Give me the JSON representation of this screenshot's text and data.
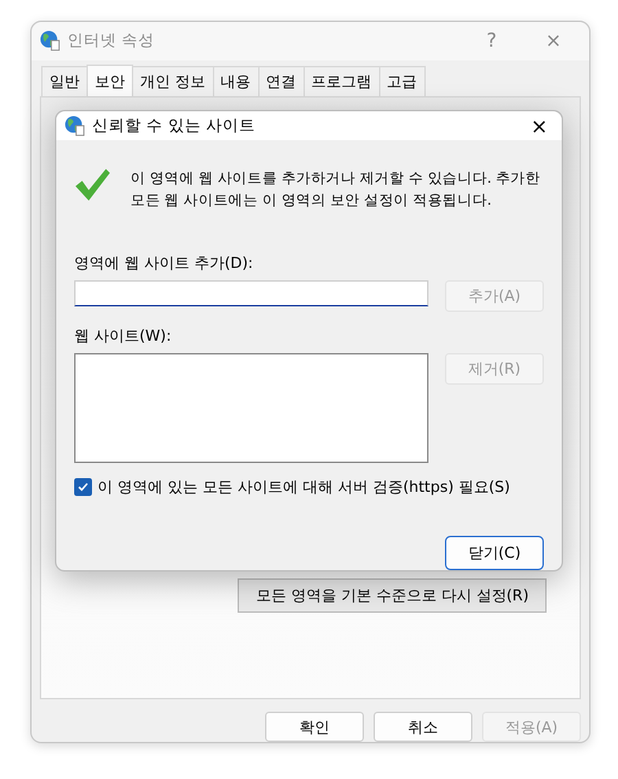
{
  "window": {
    "title": "인터넷 속성",
    "help_button": "?",
    "close_button": "×"
  },
  "tabs": [
    {
      "label": "일반",
      "selected": false
    },
    {
      "label": "보안",
      "selected": true
    },
    {
      "label": "개인 정보",
      "selected": false
    },
    {
      "label": "내용",
      "selected": false
    },
    {
      "label": "연결",
      "selected": false
    },
    {
      "label": "프로그램",
      "selected": false
    },
    {
      "label": "고급",
      "selected": false
    }
  ],
  "security_panel": {
    "reset_button": "모든 영역을 기본 수준으로 다시 설정(R)"
  },
  "buttons": [
    {
      "label": "확인",
      "disabled": false
    },
    {
      "label": "취소",
      "disabled": false
    },
    {
      "label": "적용(A)",
      "disabled": true
    }
  ],
  "dialog": {
    "title": "신뢰할 수 있는 사이트",
    "close_button": "×",
    "description": "이 영역에 웹 사이트를 추가하거나 제거할 수 있습니다. 추가한 모든 웹 사이트에는 이 영역의 보안 설정이 적용됩니다.",
    "add_label": "영역에 웹 사이트 추가(D):",
    "add_button": {
      "label": "추가(A)",
      "disabled": true
    },
    "sites_label": "웹 사이트(W):",
    "remove_button": {
      "label": "제거(R)",
      "disabled": true
    },
    "https_checkbox": {
      "label": "이 영역에 있는 모든 사이트에 대해 서버 검증(https) 필요(S)",
      "checked": true
    },
    "close_dialog_button": "닫기(C)"
  }
}
